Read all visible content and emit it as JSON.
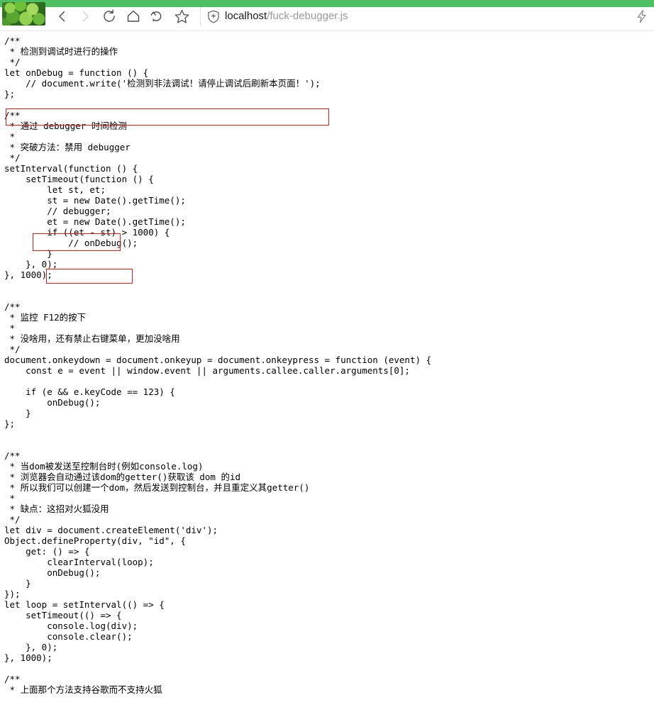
{
  "browser": {
    "accent_color": "#4fbf63",
    "avatar_alt": "profile-avatar-clover",
    "nav": {
      "back_label": "Back",
      "forward_label": "Forward",
      "reload_label": "Reload",
      "home_label": "Home",
      "history_label": "History",
      "bookmark_label": "Bookmark"
    },
    "url": {
      "host": "localhost",
      "path": "/fuck-debugger.js",
      "security_icon": "shield-plus-icon"
    },
    "extension_icon": "flash-lightning-icon"
  },
  "document": {
    "language": "javascript",
    "text_color": "#000000",
    "background": "#ffffff",
    "code": "/**\n * 检测到调试时进行的操作\n */\nlet onDebug = function () {\n    // document.write('检测到非法调试！请停止调试后刷新本页面！');\n};\n\n/**\n * 通过 debugger 时间检测\n *\n * 突破方法：禁用 debugger\n */\nsetInterval(function () {\n    setTimeout(function () {\n        let st, et;\n        st = new Date().getTime();\n        // debugger;\n        et = new Date().getTime();\n        if ((et - st) > 1000) {\n            // onDebug();\n        }\n    }, 0);\n}, 1000);\n\n\n/**\n * 监控 F12的按下\n *\n * 没啥用，还有禁止右键菜单，更加没啥用\n */\ndocument.onkeydown = document.onkeyup = document.onkeypress = function (event) {\n    const e = event || window.event || arguments.callee.caller.arguments[0];\n\n    if (e && e.keyCode == 123) {\n        onDebug();\n    }\n};\n\n\n/**\n * 当dom被发送至控制台时(例如console.log)\n * 浏览器会自动通过该dom的getter()获取该 dom 的id\n * 所以我们可以创建一个dom，然后发送到控制台，并且重定义其getter()\n *\n * 缺点：这招对火狐没用\n */\nlet div = document.createElement('div');\nObject.defineProperty(div, \"id\", {\n    get: () => {\n        clearInterval(loop);\n        onDebug();\n    }\n});\nlet loop = setInterval(() => {\n    setTimeout(() => {\n        console.log(div);\n        console.clear();\n    }, 0);\n}, 1000);\n\n/**\n * 上面那个方法支持谷歌而不支持火狐"
  },
  "annotations": {
    "color": "#e01b1b",
    "boxes": [
      {
        "id": "anno-box-1",
        "target_line": "// document.write('检测到非法调试！请停止调试后刷新本页面！');"
      },
      {
        "id": "anno-box-2",
        "target_line": "// debugger;"
      },
      {
        "id": "anno-box-3",
        "target_line": "// onDebug();"
      }
    ]
  }
}
